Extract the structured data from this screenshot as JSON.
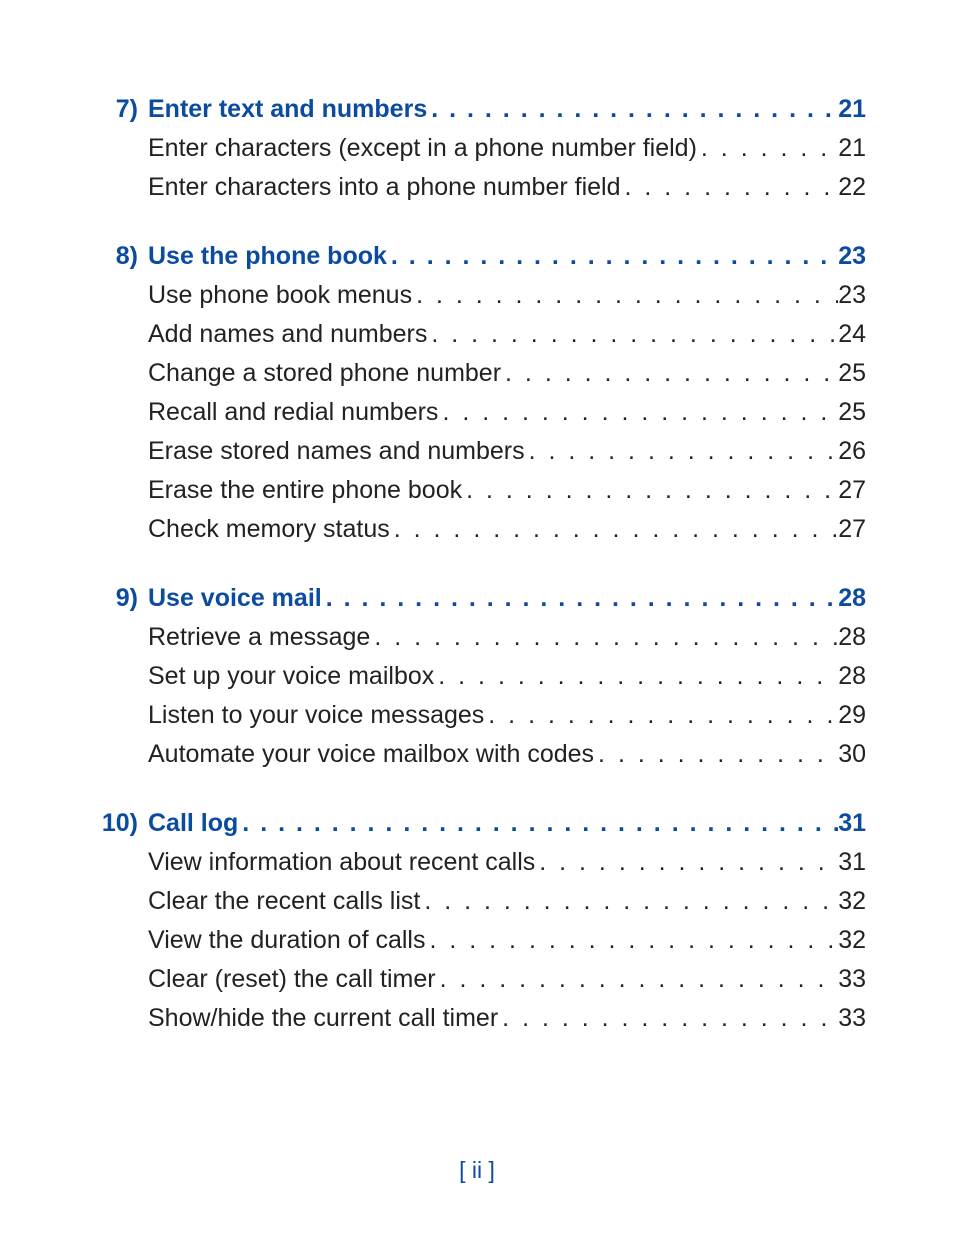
{
  "footer": "[ ii ]",
  "sections": [
    {
      "number": "7)",
      "heading": {
        "title": "Enter text and numbers",
        "page": "21"
      },
      "items": [
        {
          "title": "Enter characters (except in a phone number field)",
          "page": "21"
        },
        {
          "title": "Enter characters into a phone number field",
          "page": "22"
        }
      ]
    },
    {
      "number": "8)",
      "heading": {
        "title": "Use the phone book",
        "page": "23"
      },
      "items": [
        {
          "title": "Use phone book menus",
          "page": "23"
        },
        {
          "title": "Add names and numbers",
          "page": "24"
        },
        {
          "title": "Change a stored phone number",
          "page": "25"
        },
        {
          "title": "Recall and redial numbers",
          "page": "25"
        },
        {
          "title": "Erase stored names and numbers",
          "page": "26"
        },
        {
          "title": "Erase the entire phone book",
          "page": "27"
        },
        {
          "title": "Check memory status",
          "page": "27"
        }
      ]
    },
    {
      "number": "9)",
      "heading": {
        "title": "Use voice mail",
        "page": "28"
      },
      "items": [
        {
          "title": "Retrieve a message",
          "page": "28"
        },
        {
          "title": "Set up your voice mailbox",
          "page": "28"
        },
        {
          "title": "Listen to your voice messages",
          "page": "29"
        },
        {
          "title": "Automate your voice mailbox with codes",
          "page": "30"
        }
      ]
    },
    {
      "number": "10)",
      "heading": {
        "title": "Call log",
        "page": "31"
      },
      "items": [
        {
          "title": "View information about recent calls",
          "page": "31"
        },
        {
          "title": "Clear the recent calls list",
          "page": "32"
        },
        {
          "title": "View the duration of calls",
          "page": "32"
        },
        {
          "title": "Clear (reset) the call timer",
          "page": "33"
        },
        {
          "title": "Show/hide the current call timer",
          "page": "33"
        }
      ]
    }
  ]
}
